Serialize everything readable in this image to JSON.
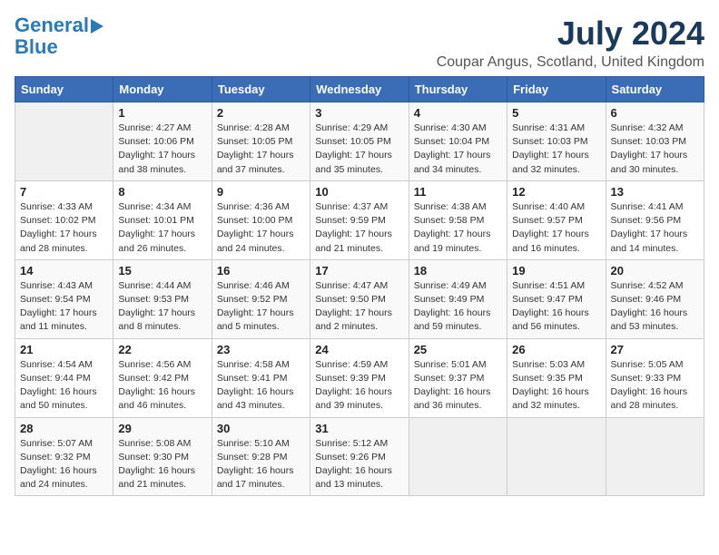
{
  "header": {
    "logo_line1": "General",
    "logo_line2": "Blue",
    "month_title": "July 2024",
    "location": "Coupar Angus, Scotland, United Kingdom"
  },
  "days_of_week": [
    "Sunday",
    "Monday",
    "Tuesday",
    "Wednesday",
    "Thursday",
    "Friday",
    "Saturday"
  ],
  "weeks": [
    [
      {
        "day": "",
        "info": ""
      },
      {
        "day": "1",
        "info": "Sunrise: 4:27 AM\nSunset: 10:06 PM\nDaylight: 17 hours\nand 38 minutes."
      },
      {
        "day": "2",
        "info": "Sunrise: 4:28 AM\nSunset: 10:05 PM\nDaylight: 17 hours\nand 37 minutes."
      },
      {
        "day": "3",
        "info": "Sunrise: 4:29 AM\nSunset: 10:05 PM\nDaylight: 17 hours\nand 35 minutes."
      },
      {
        "day": "4",
        "info": "Sunrise: 4:30 AM\nSunset: 10:04 PM\nDaylight: 17 hours\nand 34 minutes."
      },
      {
        "day": "5",
        "info": "Sunrise: 4:31 AM\nSunset: 10:03 PM\nDaylight: 17 hours\nand 32 minutes."
      },
      {
        "day": "6",
        "info": "Sunrise: 4:32 AM\nSunset: 10:03 PM\nDaylight: 17 hours\nand 30 minutes."
      }
    ],
    [
      {
        "day": "7",
        "info": "Sunrise: 4:33 AM\nSunset: 10:02 PM\nDaylight: 17 hours\nand 28 minutes."
      },
      {
        "day": "8",
        "info": "Sunrise: 4:34 AM\nSunset: 10:01 PM\nDaylight: 17 hours\nand 26 minutes."
      },
      {
        "day": "9",
        "info": "Sunrise: 4:36 AM\nSunset: 10:00 PM\nDaylight: 17 hours\nand 24 minutes."
      },
      {
        "day": "10",
        "info": "Sunrise: 4:37 AM\nSunset: 9:59 PM\nDaylight: 17 hours\nand 21 minutes."
      },
      {
        "day": "11",
        "info": "Sunrise: 4:38 AM\nSunset: 9:58 PM\nDaylight: 17 hours\nand 19 minutes."
      },
      {
        "day": "12",
        "info": "Sunrise: 4:40 AM\nSunset: 9:57 PM\nDaylight: 17 hours\nand 16 minutes."
      },
      {
        "day": "13",
        "info": "Sunrise: 4:41 AM\nSunset: 9:56 PM\nDaylight: 17 hours\nand 14 minutes."
      }
    ],
    [
      {
        "day": "14",
        "info": "Sunrise: 4:43 AM\nSunset: 9:54 PM\nDaylight: 17 hours\nand 11 minutes."
      },
      {
        "day": "15",
        "info": "Sunrise: 4:44 AM\nSunset: 9:53 PM\nDaylight: 17 hours\nand 8 minutes."
      },
      {
        "day": "16",
        "info": "Sunrise: 4:46 AM\nSunset: 9:52 PM\nDaylight: 17 hours\nand 5 minutes."
      },
      {
        "day": "17",
        "info": "Sunrise: 4:47 AM\nSunset: 9:50 PM\nDaylight: 17 hours\nand 2 minutes."
      },
      {
        "day": "18",
        "info": "Sunrise: 4:49 AM\nSunset: 9:49 PM\nDaylight: 16 hours\nand 59 minutes."
      },
      {
        "day": "19",
        "info": "Sunrise: 4:51 AM\nSunset: 9:47 PM\nDaylight: 16 hours\nand 56 minutes."
      },
      {
        "day": "20",
        "info": "Sunrise: 4:52 AM\nSunset: 9:46 PM\nDaylight: 16 hours\nand 53 minutes."
      }
    ],
    [
      {
        "day": "21",
        "info": "Sunrise: 4:54 AM\nSunset: 9:44 PM\nDaylight: 16 hours\nand 50 minutes."
      },
      {
        "day": "22",
        "info": "Sunrise: 4:56 AM\nSunset: 9:42 PM\nDaylight: 16 hours\nand 46 minutes."
      },
      {
        "day": "23",
        "info": "Sunrise: 4:58 AM\nSunset: 9:41 PM\nDaylight: 16 hours\nand 43 minutes."
      },
      {
        "day": "24",
        "info": "Sunrise: 4:59 AM\nSunset: 9:39 PM\nDaylight: 16 hours\nand 39 minutes."
      },
      {
        "day": "25",
        "info": "Sunrise: 5:01 AM\nSunset: 9:37 PM\nDaylight: 16 hours\nand 36 minutes."
      },
      {
        "day": "26",
        "info": "Sunrise: 5:03 AM\nSunset: 9:35 PM\nDaylight: 16 hours\nand 32 minutes."
      },
      {
        "day": "27",
        "info": "Sunrise: 5:05 AM\nSunset: 9:33 PM\nDaylight: 16 hours\nand 28 minutes."
      }
    ],
    [
      {
        "day": "28",
        "info": "Sunrise: 5:07 AM\nSunset: 9:32 PM\nDaylight: 16 hours\nand 24 minutes."
      },
      {
        "day": "29",
        "info": "Sunrise: 5:08 AM\nSunset: 9:30 PM\nDaylight: 16 hours\nand 21 minutes."
      },
      {
        "day": "30",
        "info": "Sunrise: 5:10 AM\nSunset: 9:28 PM\nDaylight: 16 hours\nand 17 minutes."
      },
      {
        "day": "31",
        "info": "Sunrise: 5:12 AM\nSunset: 9:26 PM\nDaylight: 16 hours\nand 13 minutes."
      },
      {
        "day": "",
        "info": ""
      },
      {
        "day": "",
        "info": ""
      },
      {
        "day": "",
        "info": ""
      }
    ]
  ]
}
